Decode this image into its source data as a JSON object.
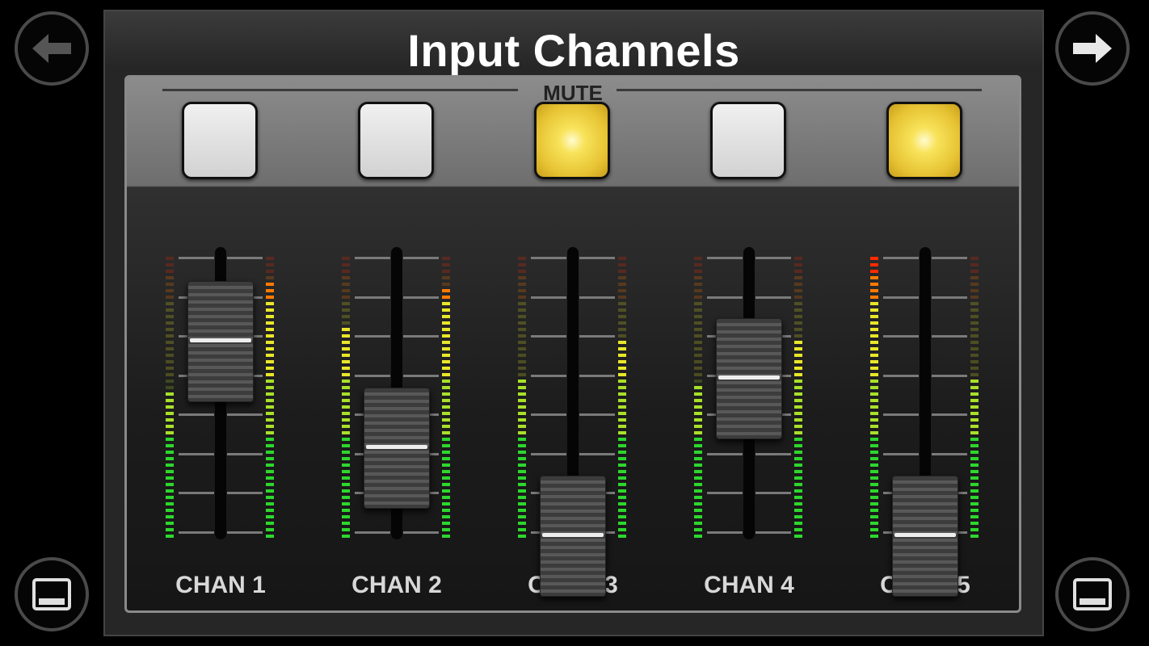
{
  "title": "Input Channels",
  "mute_label": "MUTE",
  "colors": {
    "mute_on": "#f2d540",
    "mute_off": "#e2e2e2",
    "meter_green": "#2ed62e",
    "meter_yellow": "#e8e62a",
    "meter_red": "#ff2a00"
  },
  "nav": {
    "prev_icon": "arrow-left-icon",
    "next_icon": "arrow-right-icon",
    "view_icon": "window-panel-icon"
  },
  "channels": [
    {
      "name": "CHAN 1",
      "mute": false,
      "fader": 0.86,
      "meter_left": 0.52,
      "meter_right": 0.91
    },
    {
      "name": "CHAN 2",
      "mute": false,
      "fader": 0.4,
      "meter_left": 0.76,
      "meter_right": 0.89
    },
    {
      "name": "CHAN 3",
      "mute": true,
      "fader": 0.02,
      "meter_left": 0.57,
      "meter_right": 0.7
    },
    {
      "name": "CHAN 4",
      "mute": false,
      "fader": 0.7,
      "meter_left": 0.55,
      "meter_right": 0.71
    },
    {
      "name": "CHAN 5",
      "mute": true,
      "fader": 0.02,
      "meter_left": 0.99,
      "meter_right": 0.56
    }
  ]
}
